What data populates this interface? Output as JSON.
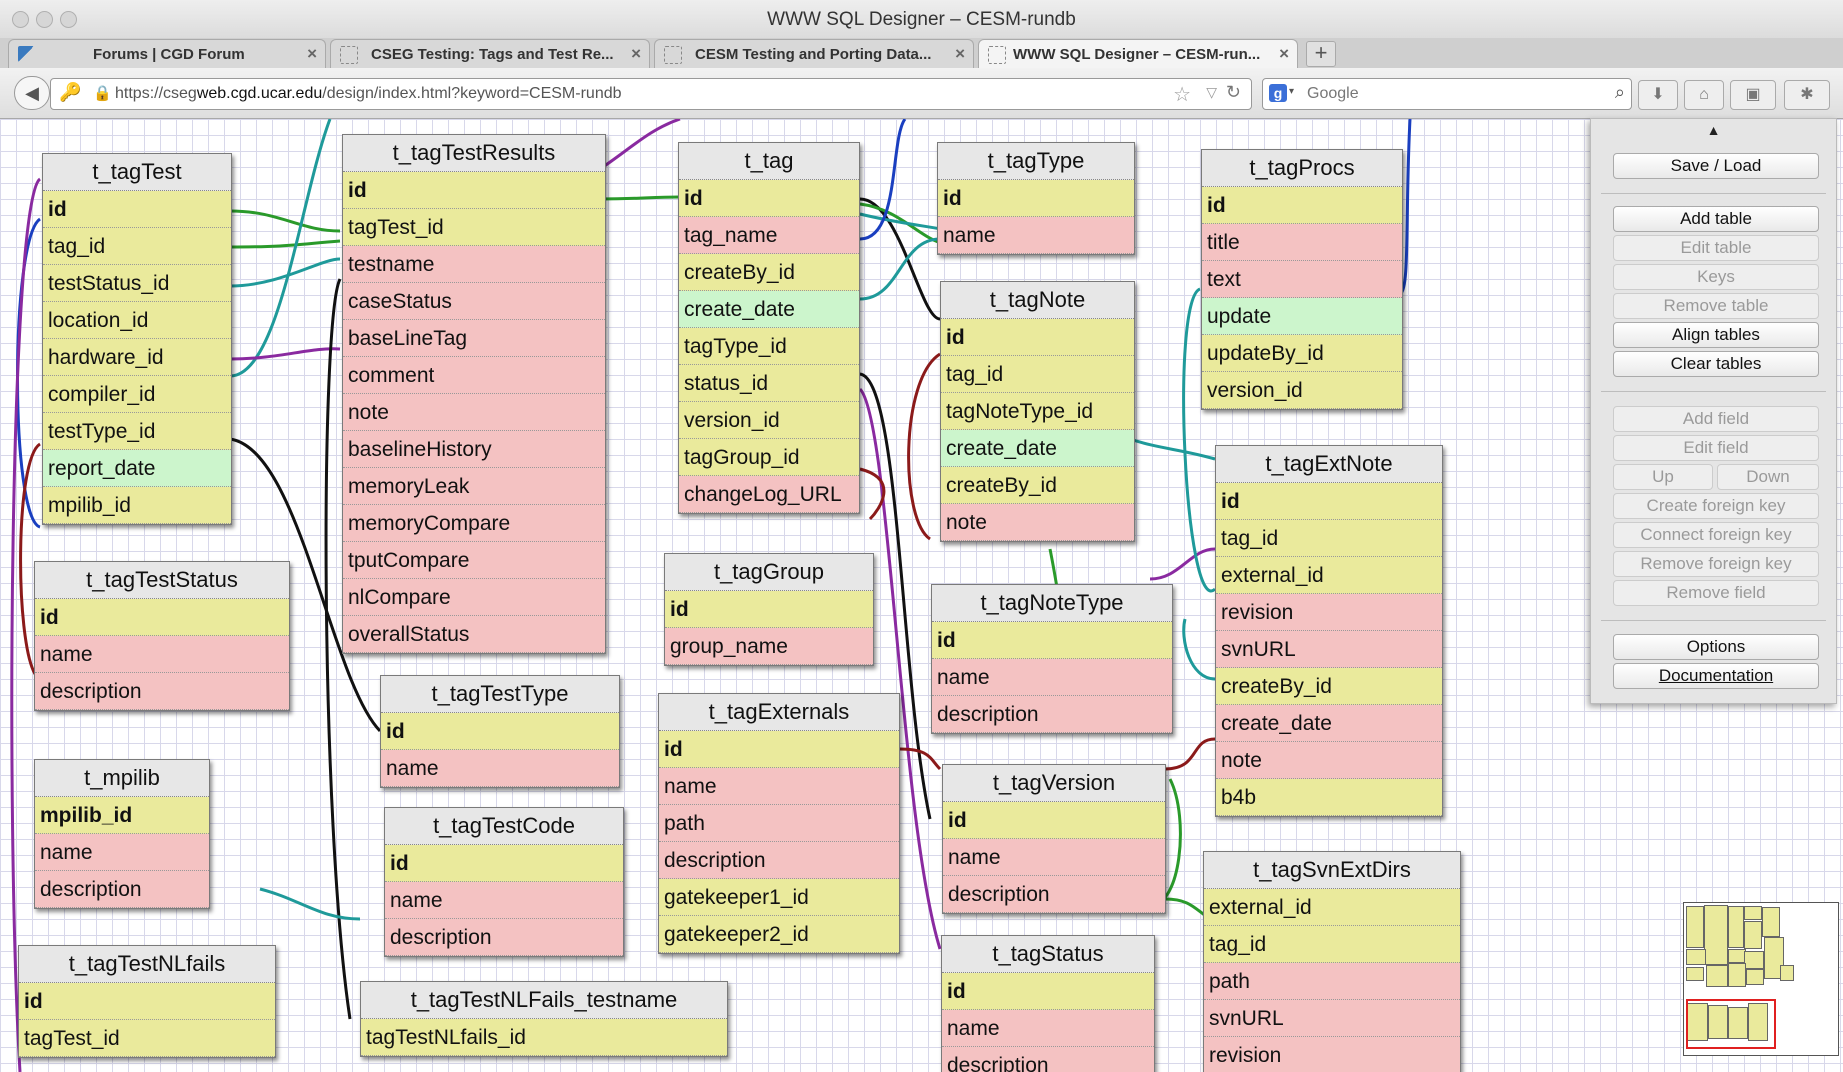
{
  "window": {
    "title": "WWW SQL Designer – CESM-rundb"
  },
  "tabs": [
    {
      "label": "Forums | CGD Forum"
    },
    {
      "label": "CSEG Testing: Tags and Test Re..."
    },
    {
      "label": "CESM Testing and Porting Data..."
    },
    {
      "label": "WWW SQL Designer – CESM-run..."
    }
  ],
  "tab_close": "×",
  "new_tab": "+",
  "address": {
    "prefix": "https://cseg",
    "host": "web.cgd.ucar.edu",
    "path": "/design/index.html?keyword=CESM-rundb"
  },
  "search": {
    "placeholder": "Google"
  },
  "colors": {
    "key_field": "#eaea9c",
    "plain_field": "#f4c2c2",
    "date_field": "#ccf5cc",
    "grid": "#d8d8ea"
  },
  "tables": {
    "t_tagTest": {
      "name": "t_tagTest",
      "fields": [
        "id",
        "tag_id",
        "testStatus_id",
        "location_id",
        "hardware_id",
        "compiler_id",
        "testType_id",
        "report_date",
        "mpilib_id"
      ]
    },
    "t_tagTestResults": {
      "name": "t_tagTestResults",
      "fields": [
        "id",
        "tagTest_id",
        "testname",
        "caseStatus",
        "baseLineTag",
        "comment",
        "note",
        "baselineHistory",
        "memoryLeak",
        "memoryCompare",
        "tputCompare",
        "nlCompare",
        "overallStatus"
      ]
    },
    "t_tag": {
      "name": "t_tag",
      "fields": [
        "id",
        "tag_name",
        "createBy_id",
        "create_date",
        "tagType_id",
        "status_id",
        "version_id",
        "tagGroup_id",
        "changeLog_URL"
      ]
    },
    "t_tagType": {
      "name": "t_tagType",
      "fields": [
        "id",
        "name"
      ]
    },
    "t_tagProcs": {
      "name": "t_tagProcs",
      "fields": [
        "id",
        "title",
        "text",
        "update",
        "updateBy_id",
        "version_id"
      ]
    },
    "t_tagNote": {
      "name": "t_tagNote",
      "fields": [
        "id",
        "tag_id",
        "tagNoteType_id",
        "create_date",
        "createBy_id",
        "note"
      ]
    },
    "t_tagExtNote": {
      "name": "t_tagExtNote",
      "fields": [
        "id",
        "tag_id",
        "external_id",
        "revision",
        "svnURL",
        "createBy_id",
        "create_date",
        "note",
        "b4b"
      ]
    },
    "t_tagTestStatus": {
      "name": "t_tagTestStatus",
      "fields": [
        "id",
        "name",
        "description"
      ]
    },
    "t_tagGroup": {
      "name": "t_tagGroup",
      "fields": [
        "id",
        "group_name"
      ]
    },
    "t_tagNoteType": {
      "name": "t_tagNoteType",
      "fields": [
        "id",
        "name",
        "description"
      ]
    },
    "t_tagTestType": {
      "name": "t_tagTestType",
      "fields": [
        "id",
        "name"
      ]
    },
    "t_tagExternals": {
      "name": "t_tagExternals",
      "fields": [
        "id",
        "name",
        "path",
        "description",
        "gatekeeper1_id",
        "gatekeeper2_id"
      ]
    },
    "t_mpilib": {
      "name": "t_mpilib",
      "fields": [
        "mpilib_id",
        "name",
        "description"
      ]
    },
    "t_tagTestCode": {
      "name": "t_tagTestCode",
      "fields": [
        "id",
        "name",
        "description"
      ]
    },
    "t_tagVersion": {
      "name": "t_tagVersion",
      "fields": [
        "id",
        "name",
        "description"
      ]
    },
    "t_tagSvnExtDirs": {
      "name": "t_tagSvnExtDirs",
      "fields": [
        "external_id",
        "tag_id",
        "path",
        "svnURL",
        "revision"
      ]
    },
    "t_tagStatus": {
      "name": "t_tagStatus",
      "fields": [
        "id",
        "name",
        "description"
      ]
    },
    "t_tagTestNLfails": {
      "name": "t_tagTestNLfails",
      "fields": [
        "id",
        "tagTest_id"
      ]
    },
    "t_tagTestNLFails_testname": {
      "name": "t_tagTestNLFails_testname",
      "fields": [
        "tagTestNLfails_id"
      ]
    }
  },
  "panel": {
    "up_arrow": "▲",
    "save_load": "Save / Load",
    "add_table": "Add table",
    "edit_table": "Edit table",
    "keys": "Keys",
    "remove_table": "Remove table",
    "align_tables": "Align tables",
    "clear_tables": "Clear tables",
    "add_field": "Add field",
    "edit_field": "Edit field",
    "up": "Up",
    "down": "Down",
    "create_foreign_key": "Create foreign key",
    "connect_foreign_key": "Connect foreign key",
    "remove_foreign_key": "Remove foreign key",
    "remove_field": "Remove field",
    "options": "Options",
    "documentation": "Documentation"
  }
}
